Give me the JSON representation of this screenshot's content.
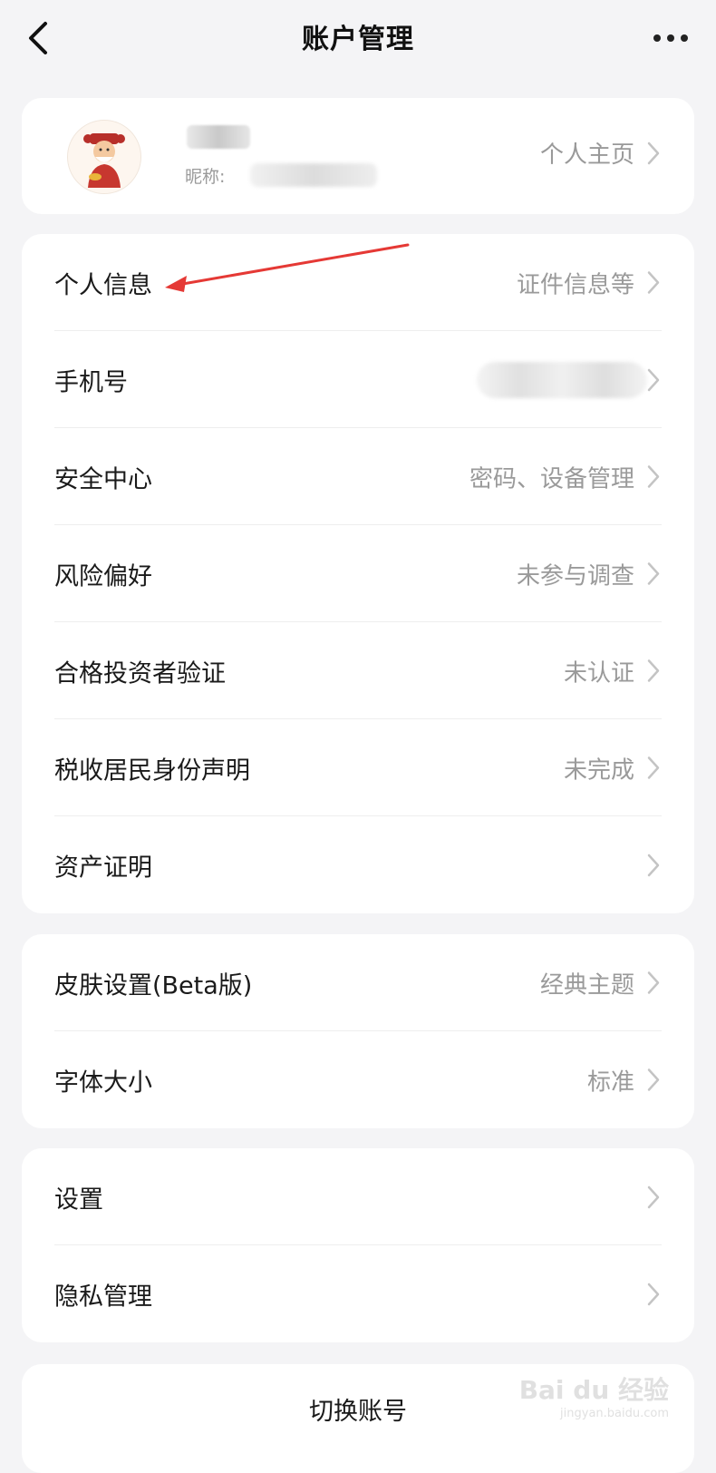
{
  "header": {
    "title": "账户管理",
    "back_icon": "chevron-left-icon",
    "more_icon": "more-horizontal-icon"
  },
  "profile": {
    "nickname_label": "昵称:",
    "homepage_link": "个人主页"
  },
  "account_section": {
    "items": [
      {
        "label": "个人信息",
        "value": "证件信息等"
      },
      {
        "label": "手机号",
        "value": ""
      },
      {
        "label": "安全中心",
        "value": "密码、设备管理"
      },
      {
        "label": "风险偏好",
        "value": "未参与调查"
      },
      {
        "label": "合格投资者验证",
        "value": "未认证"
      },
      {
        "label": "税收居民身份声明",
        "value": "未完成"
      },
      {
        "label": "资产证明",
        "value": ""
      }
    ]
  },
  "display_section": {
    "items": [
      {
        "label": "皮肤设置(Beta版)",
        "value": "经典主题"
      },
      {
        "label": "字体大小",
        "value": "标准"
      }
    ]
  },
  "system_section": {
    "items": [
      {
        "label": "设置",
        "value": ""
      },
      {
        "label": "隐私管理",
        "value": ""
      }
    ]
  },
  "footer": {
    "switch_account": "切换账号"
  },
  "watermark": {
    "main": "Bai du 经验",
    "sub": "jingyan.baidu.com"
  },
  "colors": {
    "background": "#f4f4f6",
    "card": "#ffffff",
    "annotation_arrow": "#e53935",
    "secondary_text": "#9a9a9a"
  }
}
